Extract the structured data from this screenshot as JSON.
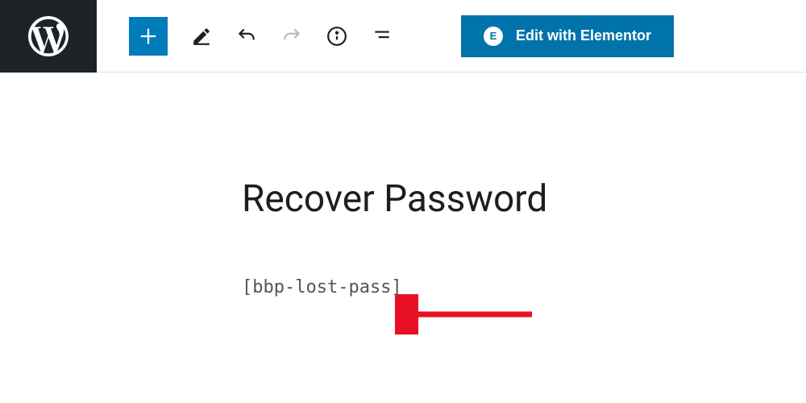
{
  "toolbar": {
    "elementor_label": "Edit with Elementor"
  },
  "content": {
    "title": "Recover Password",
    "shortcode": "[bbp-lost-pass]"
  }
}
